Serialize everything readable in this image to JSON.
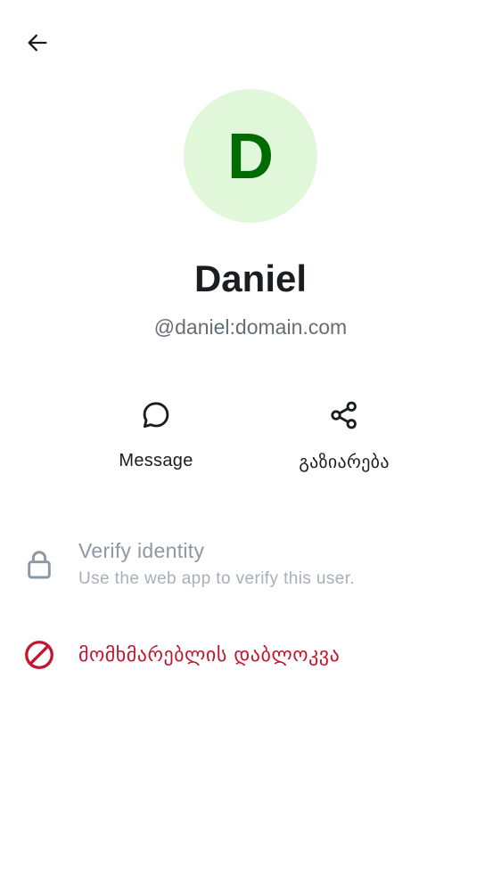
{
  "header": {
    "back_icon": "arrow-left-icon"
  },
  "profile": {
    "avatar_initial": "D",
    "avatar_bg": "#e0f8d9",
    "avatar_fg": "#006b00",
    "display_name": "Daniel",
    "user_id": "@daniel:domain.com"
  },
  "actions": {
    "message": {
      "icon": "chat-bubble-icon",
      "label": "Message"
    },
    "share": {
      "icon": "share-icon",
      "label": "გაზიარება"
    }
  },
  "verify": {
    "icon": "lock-icon",
    "title": "Verify identity",
    "subtitle": "Use the web app to verify this user."
  },
  "block": {
    "icon": "block-icon",
    "label": "მომხმარებლის დაბლოკვა",
    "color": "#c21630"
  }
}
